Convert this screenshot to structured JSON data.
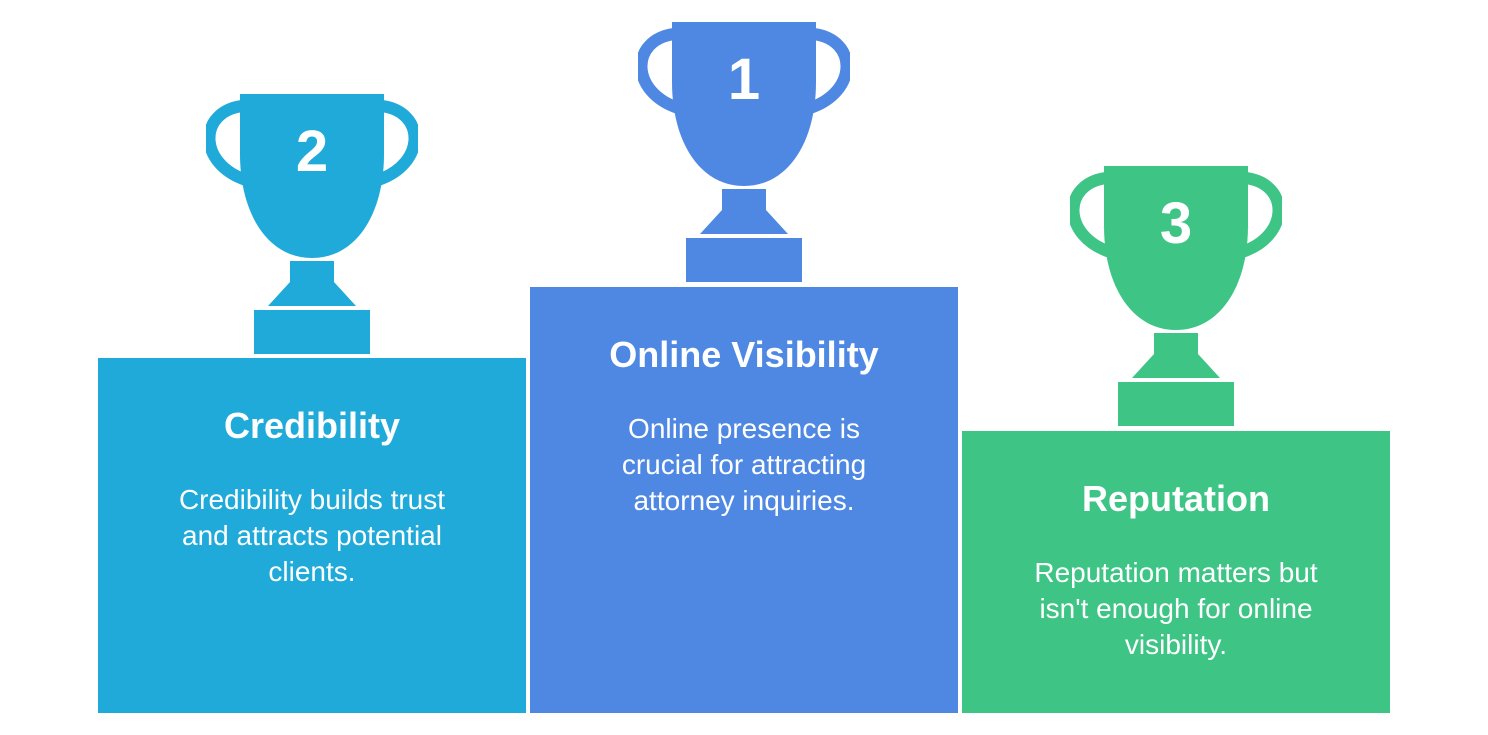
{
  "colors": {
    "second": "#1faad9",
    "first": "#4e88e3",
    "third": "#3ec586",
    "text": "#ffffff",
    "background": "#ffffff"
  },
  "icons": {
    "trophy": "trophy-icon"
  },
  "podiums": {
    "first": {
      "rank": "1",
      "title": "Online Visibility",
      "description": "Online presence is crucial for attracting attorney inquiries."
    },
    "second": {
      "rank": "2",
      "title": "Credibility",
      "description": "Credibility builds trust and attracts potential clients."
    },
    "third": {
      "rank": "3",
      "title": "Reputation",
      "description": "Reputation matters but isn't enough for online visibility."
    }
  }
}
